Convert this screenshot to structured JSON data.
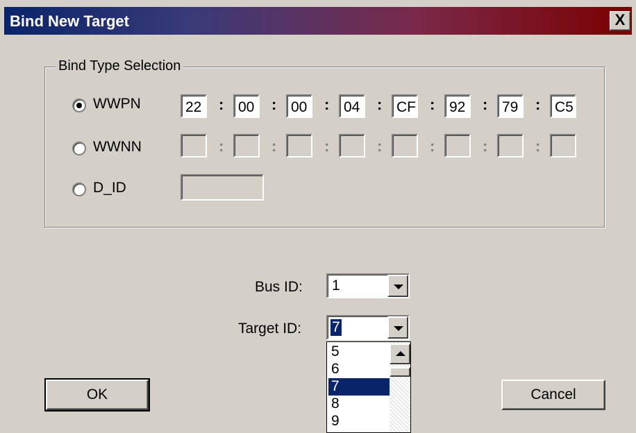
{
  "window": {
    "title": "Bind New Target",
    "close_label": "X"
  },
  "bind_type": {
    "legend": "Bind Type Selection",
    "wwpn": {
      "label": "WWPN",
      "selected": true,
      "octets": [
        "22",
        "00",
        "00",
        "04",
        "CF",
        "92",
        "79",
        "C5"
      ]
    },
    "wwnn": {
      "label": "WWNN",
      "selected": false,
      "octets": [
        "",
        "",
        "",
        "",
        "",
        "",
        "",
        ""
      ]
    },
    "d_id": {
      "label": "D_ID",
      "selected": false,
      "value": ""
    },
    "separator": ":"
  },
  "bus_id": {
    "label": "Bus ID:",
    "value": "1"
  },
  "target_id": {
    "label": "Target ID:",
    "value": "7",
    "options": [
      "5",
      "6",
      "7",
      "8",
      "9"
    ],
    "selected_option": "7"
  },
  "buttons": {
    "ok": "OK",
    "cancel": "Cancel"
  }
}
